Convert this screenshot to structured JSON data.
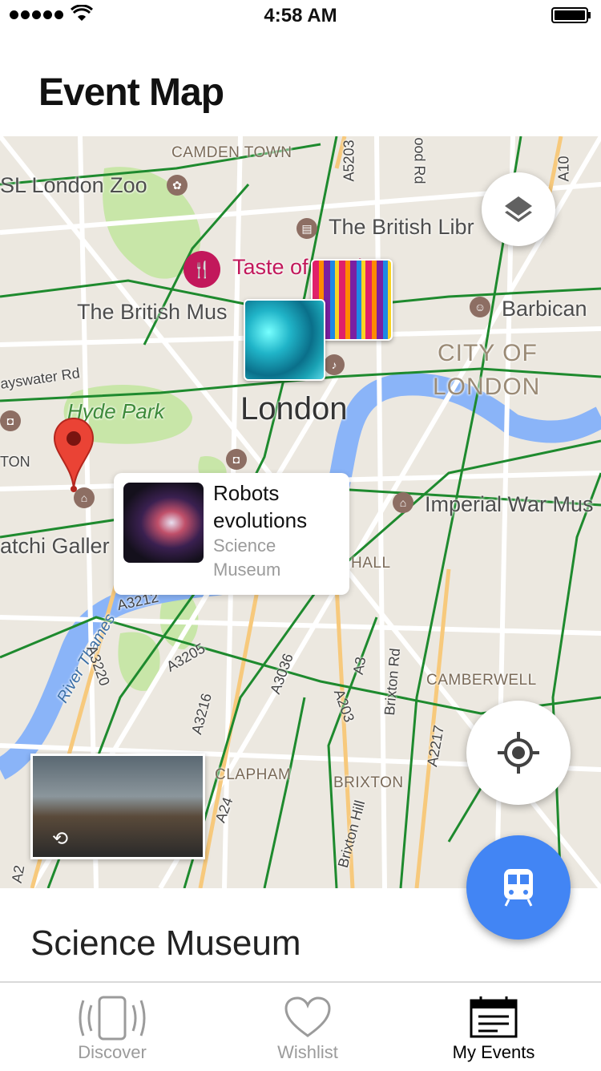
{
  "status_bar": {
    "time": "4:58 AM"
  },
  "header": {
    "title": "Event Map"
  },
  "map": {
    "labels": {
      "camden": "CAMDEN TOWN",
      "zoo": "SL London Zoo",
      "british_library": "The British Libr",
      "taste": "Taste of London",
      "british_museum": "The British Mus",
      "barbican": "Barbican",
      "city": "CITY OF",
      "city2": "LONDON",
      "bayswater": "ayswater Rd",
      "hyde_park": "Hyde Park",
      "london": "London",
      "ton": "TON",
      "saatchi": "atchi Galler",
      "imperial": "Imperial War Mus",
      "hall": "HALL",
      "river": "River Thames",
      "camberwell": "CAMBERWELL",
      "clapham": "CLAPHAM",
      "brixton": "BRIXTON",
      "brixton_rd": "Brixton Rd",
      "brixton_hill": "Brixton Hill",
      "a3212": "A3212",
      "a3205": "A3205",
      "a3036": "A3036",
      "a3220": "A3220",
      "a3216": "A3216",
      "a203": "A203",
      "a3": "A3",
      "a2217": "A2217",
      "a24": "A24",
      "a10": "A10",
      "a5203": "A5203",
      "pood_rd": "ood Rd",
      "a2": "A2"
    },
    "event_card": {
      "title": "Robots evolutions",
      "venue": "Science Museum"
    }
  },
  "selected_place": {
    "name": "Science Museum"
  },
  "tabs": [
    {
      "label": "Discover",
      "active": false
    },
    {
      "label": "Wishlist",
      "active": false
    },
    {
      "label": "My Events",
      "active": true
    }
  ],
  "colors": {
    "transit_button": "#4285f4",
    "map_bg": "#ece8e0",
    "park": "#c8e6a8",
    "water": "#8ab4f8",
    "transit_lines": "#1e8a2e"
  }
}
